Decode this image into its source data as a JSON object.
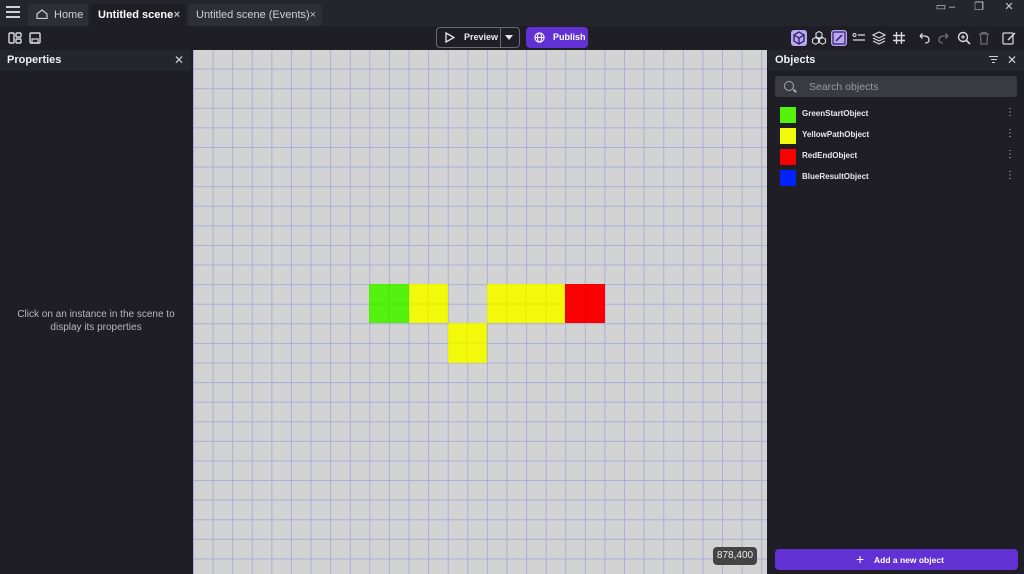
{
  "tabs": {
    "home": "Home",
    "scene": "Untitled scene",
    "events": "Untitled scene (Events)",
    "close_glyph": "×"
  },
  "toolbar": {
    "preview_label": "Preview",
    "publish_label": "Publish"
  },
  "properties": {
    "title": "Properties",
    "hint": "Click on an instance in the scene to display its properties"
  },
  "objects_panel": {
    "title": "Objects",
    "search_placeholder": "Search objects",
    "items": [
      {
        "name": "GreenStartObject",
        "color": "#55f20e"
      },
      {
        "name": "YellowPathObject",
        "color": "#f2f90b"
      },
      {
        "name": "RedEndObject",
        "color": "#fa0000"
      },
      {
        "name": "BlueResultObject",
        "color": "#0022ff"
      }
    ],
    "add_label": "Add a new object"
  },
  "scene": {
    "coords": "878,400",
    "grid_cells": [
      {
        "col": 9,
        "row": 12,
        "obj": "GreenStartObject"
      },
      {
        "col": 10,
        "row": 12,
        "obj": "GreenStartObject"
      },
      {
        "col": 9,
        "row": 13,
        "obj": "GreenStartObject"
      },
      {
        "col": 10,
        "row": 13,
        "obj": "GreenStartObject"
      },
      {
        "col": 11,
        "row": 12,
        "obj": "YellowPathObject"
      },
      {
        "col": 12,
        "row": 12,
        "obj": "YellowPathObject"
      },
      {
        "col": 11,
        "row": 13,
        "obj": "YellowPathObject"
      },
      {
        "col": 12,
        "row": 13,
        "obj": "YellowPathObject"
      },
      {
        "col": 13,
        "row": 14,
        "obj": "YellowPathObject"
      },
      {
        "col": 14,
        "row": 14,
        "obj": "YellowPathObject"
      },
      {
        "col": 13,
        "row": 15,
        "obj": "YellowPathObject"
      },
      {
        "col": 14,
        "row": 15,
        "obj": "YellowPathObject"
      },
      {
        "col": 15,
        "row": 12,
        "obj": "YellowPathObject"
      },
      {
        "col": 16,
        "row": 12,
        "obj": "YellowPathObject"
      },
      {
        "col": 17,
        "row": 12,
        "obj": "YellowPathObject"
      },
      {
        "col": 18,
        "row": 12,
        "obj": "YellowPathObject"
      },
      {
        "col": 15,
        "row": 13,
        "obj": "YellowPathObject"
      },
      {
        "col": 16,
        "row": 13,
        "obj": "YellowPathObject"
      },
      {
        "col": 17,
        "row": 13,
        "obj": "YellowPathObject"
      },
      {
        "col": 18,
        "row": 13,
        "obj": "YellowPathObject"
      },
      {
        "col": 19,
        "row": 12,
        "obj": "RedEndObject"
      },
      {
        "col": 20,
        "row": 12,
        "obj": "RedEndObject"
      },
      {
        "col": 19,
        "row": 13,
        "obj": "RedEndObject"
      },
      {
        "col": 20,
        "row": 13,
        "obj": "RedEndObject"
      }
    ]
  }
}
